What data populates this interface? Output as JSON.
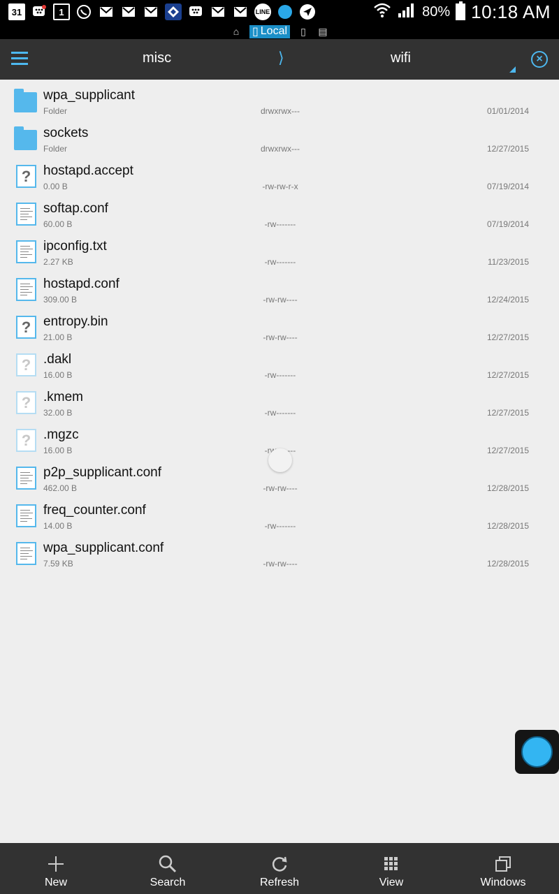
{
  "status_bar": {
    "icons": [
      "calendar-31-icon",
      "bbm-notification-icon",
      "calendar-1-icon",
      "whatsapp-icon",
      "gmail-icon",
      "gmail-icon",
      "gmail-icon",
      "app-diamond-icon",
      "bbm-icon",
      "gmail-icon",
      "gmail-icon",
      "line-icon",
      "blue-dot-icon",
      "telegram-icon"
    ],
    "calendar_day": "31",
    "calendar_day2": "1",
    "line_label": "LINE",
    "battery_pct": "80%",
    "time": "10:18 AM"
  },
  "location_bar": {
    "local_label": "Local"
  },
  "toolbar": {
    "crumbs": [
      "misc",
      "wifi"
    ],
    "separator": "⟩",
    "close_glyph": "×"
  },
  "files": [
    {
      "name": "wpa_supplicant",
      "sub": "Folder",
      "perm": "drwxrwx---",
      "date": "01/01/2014",
      "icon": "folder"
    },
    {
      "name": "sockets",
      "sub": "Folder",
      "perm": "drwxrwx---",
      "date": "12/27/2015",
      "icon": "folder"
    },
    {
      "name": "hostapd.accept",
      "sub": "0.00 B",
      "perm": "-rw-rw-r-x",
      "date": "07/19/2014",
      "icon": "unknown"
    },
    {
      "name": "softap.conf",
      "sub": "60.00 B",
      "perm": "-rw-------",
      "date": "07/19/2014",
      "icon": "doc"
    },
    {
      "name": "ipconfig.txt",
      "sub": "2.27 KB",
      "perm": "-rw-------",
      "date": "11/23/2015",
      "icon": "doc"
    },
    {
      "name": "hostapd.conf",
      "sub": "309.00 B",
      "perm": "-rw-rw----",
      "date": "12/24/2015",
      "icon": "doc"
    },
    {
      "name": "entropy.bin",
      "sub": "21.00 B",
      "perm": "-rw-rw----",
      "date": "12/27/2015",
      "icon": "unknown"
    },
    {
      "name": ".dakl",
      "sub": "16.00 B",
      "perm": "-rw-------",
      "date": "12/27/2015",
      "icon": "unknown-faded"
    },
    {
      "name": ".kmem",
      "sub": "32.00 B",
      "perm": "-rw-------",
      "date": "12/27/2015",
      "icon": "unknown-faded"
    },
    {
      "name": ".mgzc",
      "sub": "16.00 B",
      "perm": "-rw-------",
      "date": "12/27/2015",
      "icon": "unknown-faded"
    },
    {
      "name": "p2p_supplicant.conf",
      "sub": "462.00 B",
      "perm": "-rw-rw----",
      "date": "12/28/2015",
      "icon": "doc"
    },
    {
      "name": "freq_counter.conf",
      "sub": "14.00 B",
      "perm": "-rw-------",
      "date": "12/28/2015",
      "icon": "doc"
    },
    {
      "name": "wpa_supplicant.conf",
      "sub": "7.59 KB",
      "perm": "-rw-rw----",
      "date": "12/28/2015",
      "icon": "doc"
    }
  ],
  "bottom_bar": [
    {
      "label": "New",
      "icon": "plus-icon"
    },
    {
      "label": "Search",
      "icon": "search-icon"
    },
    {
      "label": "Refresh",
      "icon": "refresh-icon"
    },
    {
      "label": "View",
      "icon": "grid-icon"
    },
    {
      "label": "Windows",
      "icon": "windows-icon"
    }
  ],
  "colors": {
    "accent": "#4db8ef",
    "toolbar_bg": "#323232",
    "list_bg": "#eeeeee"
  }
}
